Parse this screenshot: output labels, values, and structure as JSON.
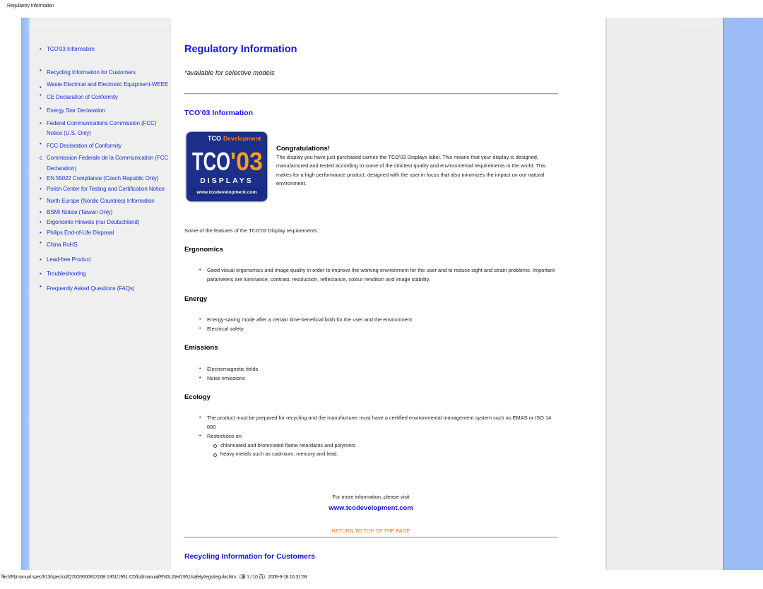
{
  "print_header": "Regulatory Information",
  "print_footer": "file:///F|/manual spec/813/spec/cd/Q70G900081316B 1951/1951 CD/lcd/manual/ENGLISH/1951/safety/regs/regulat.htm（第 1 / 10 页）2009-9-18 16:31:59",
  "nav": {
    "items": [
      {
        "label": "TCO'03 Information",
        "bullet": "•"
      },
      {
        "label": "Recycling Information for Customers",
        "bullet": "•"
      },
      {
        "label": "Waste Electrical and Electronic Equipment-WEEE",
        "bullet": "•"
      },
      {
        "label": "CE Declaration of Conformity",
        "bullet": "•"
      },
      {
        "label": "Energy Star Declaration",
        "bullet": "•"
      },
      {
        "label": "Federal Communications Commission (FCC) Notice (U.S. Only)",
        "bullet": "•"
      },
      {
        "label": "FCC Declaration of Conformity",
        "bullet": "•"
      },
      {
        "label": "Commission Federale de la Communication (FCC Declaration)",
        "bullet": "c"
      },
      {
        "label": "EN 55022 Compliance (Czech Republic Only)",
        "bullet": "•"
      },
      {
        "label": "Polish Center for Testing and Certification Notice",
        "bullet": "•"
      },
      {
        "label": "North Europe (Nordic Countries) Information",
        "bullet": "•"
      },
      {
        "label": "BSMI Notice (Taiwan Only)",
        "bullet": "•"
      },
      {
        "label": "Ergonomie Hinweis (nur Deutschland)",
        "bullet": "•"
      },
      {
        "label": "Philips End-of-Life Disposal",
        "bullet": "•"
      },
      {
        "label": "China RoHS",
        "bullet": "•"
      },
      {
        "label": "Lead-free Product",
        "bullet": "•"
      },
      {
        "label": "Troubleshooting",
        "bullet": "•"
      },
      {
        "label": "Frequently Asked Questions (FAQs)",
        "bullet": "•"
      }
    ]
  },
  "main": {
    "title": "Regulatory Information",
    "subtitle": "*available for selective models",
    "tco_section_title": "TCO'03 Information",
    "logo": {
      "top_text_1": "TCO",
      "top_text_2": "Development",
      "big_left": "TCO",
      "big_right": "'03",
      "displays": "DISPLAYS",
      "url": "www.tcodevelopment.com"
    },
    "congrats": {
      "heading": "Congratulations!",
      "body": "The display you have just purchased carries the TCO'03 Displays label. This means that your display is designed, manufactured and tested according to some of the strictest quality and environmental requirements in the world. This makes for a high performance product, designed with the user in focus that also minimizes the impact on our natural environment."
    },
    "features_intro": "Some of the features of the TCO'03 Display requirements.",
    "ergonomics": {
      "heading": "Ergonomics",
      "items": [
        "Good visual ergonomics and image quality in order to improve the working environment for the user and to reduce sight and strain problems. Important parameters are luminance, contrast, resoluction, reflectance, colour rendition and image stability."
      ]
    },
    "energy": {
      "heading": "Energy",
      "items": [
        "Energy-saving mode after a certain time-beneficial both for the user and the environment",
        "Electrical safety"
      ]
    },
    "emissions": {
      "heading": "Emissions",
      "items": [
        "Electromagnetic fields",
        "Noise emissions"
      ]
    },
    "ecology": {
      "heading": "Ecology",
      "items": [
        "The product must be prepared for recycling and the manufacturer must have a certified environmental management system such as EMAS or ISO 14 000",
        "Restrictions on"
      ],
      "sub_items": [
        "chlorinated and brominated flame retardants and polymers",
        "heavy metals such as cadmium, mercury and lead."
      ]
    },
    "more_info": "For more information, please visit",
    "more_info_link": "www.tcodevelopment.com",
    "return_top": "RETURN TO TOP OF THE PAGE",
    "recycling_section_title": "Recycling Information for Customers"
  },
  "colors": {
    "link_blue": "#1414e6",
    "nav_link": "#1a33d9",
    "return_orange": "#ff7a14",
    "side_blue": "#9bbcf7",
    "panel_gray": "#efefef"
  }
}
